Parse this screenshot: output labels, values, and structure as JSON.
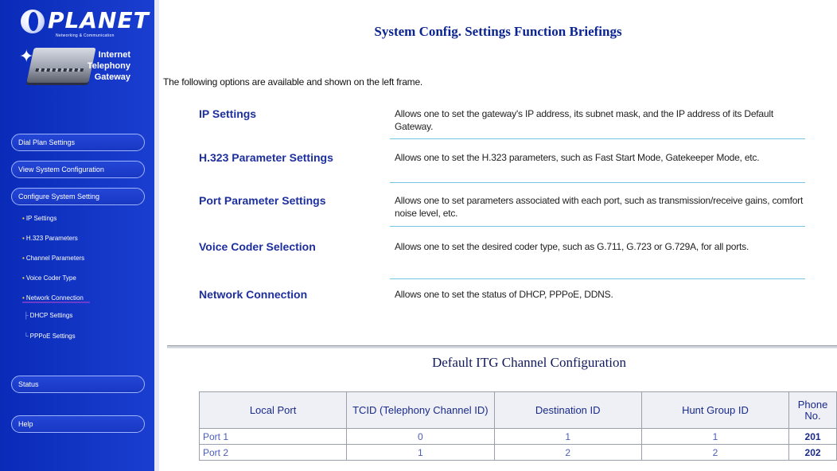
{
  "brand": {
    "logo_text": "PLANET",
    "logo_sub": "Networking & Communication",
    "product_name": [
      "Internet",
      "Telephony",
      "Gateway"
    ]
  },
  "nav": {
    "dial_plan": "Dial Plan Settings",
    "view_config": "View System Configuration",
    "configure": "Configure System Setting",
    "sub_items": [
      "IP Settings",
      "H.323 Parameters",
      "Channel Parameters",
      "Voice Coder Type",
      "Network Connection"
    ],
    "sub_sub_items": [
      "DHCP Settings",
      "PPPoE Settings"
    ],
    "status": "Status",
    "help": "Help"
  },
  "main": {
    "title": "System Config. Settings Function Briefings",
    "intro": "The following options are available and shown on the left frame.",
    "options": [
      {
        "name": "IP Settings",
        "desc": "Allows one to set the gateway's IP address, its subnet mask, and the IP address of its Default Gateway."
      },
      {
        "name": "H.323 Parameter Settings",
        "desc": "Allows one to set the H.323 parameters, such as Fast Start Mode, Gatekeeper Mode, etc."
      },
      {
        "name": "Port Parameter Settings",
        "desc": "Allows one to set parameters associated with each port, such as transmission/receive gains, comfort noise level, etc."
      },
      {
        "name": "Voice Coder Selection",
        "desc": "Allows one to set the desired coder type, such as G.711, G.723 or G.729A, for all ports."
      },
      {
        "name": "Network Connection",
        "desc": "Allows one to set the status of DHCP, PPPoE, DDNS."
      }
    ]
  },
  "table": {
    "title": "Default ITG Channel Configuration",
    "headers": [
      "Local Port",
      "TCID (Telephony Channel ID)",
      "Destination ID",
      "Hunt Group ID",
      "Phone No."
    ],
    "rows": [
      [
        "Port 1",
        "0",
        "1",
        "1",
        "201"
      ],
      [
        "Port 2",
        "1",
        "2",
        "2",
        "202"
      ]
    ]
  },
  "colors": {
    "sidebar_bg": "#0b2ec4",
    "heading_blue": "#1d2f9e",
    "divider_cyan": "#78c4e8"
  }
}
